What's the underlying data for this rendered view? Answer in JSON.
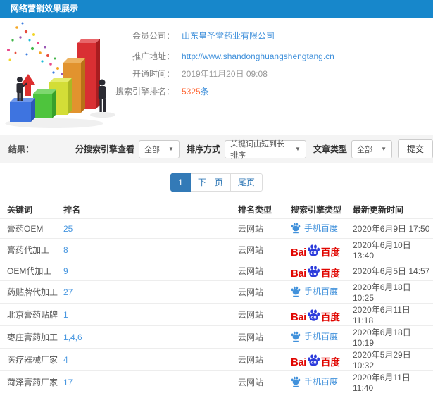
{
  "header": {
    "title": "网络营销效果展示",
    "bar_color": "#1787cb"
  },
  "info": {
    "company_label": "会员公司：",
    "company_value": "山东皇圣堂药业有限公司",
    "url_label": "推广地址：",
    "url_value": "http://www.shandonghuangshengtang.cn",
    "opened_label": "开通时间：",
    "opened_value": "2019年11月20日 09:08",
    "rank_label": "搜索引擎排名：",
    "rank_count": "5325",
    "rank_unit": "条"
  },
  "filters": {
    "result_label": "结果：",
    "engine_label": "分搜索引擎查看",
    "engine_value": "全部",
    "sort_label": "排序方式",
    "sort_value": "关键词由短到长排序",
    "type_label": "文章类型",
    "type_value": "全部",
    "submit_label": "提交"
  },
  "pagination": {
    "current": "1",
    "next": "下一页",
    "last": "尾页"
  },
  "table": {
    "headers": [
      "关键词",
      "排名",
      "排名类型",
      "搜索引擎类型",
      "最新更新时间"
    ],
    "engine_logos": {
      "mobile": {
        "label": "手机百度",
        "color": "#4191db"
      },
      "pc": {
        "bai": "Bai",
        "du": "du",
        "cn": "百度",
        "red": "#e10601",
        "blue": "#2b3bdb"
      }
    },
    "rows": [
      {
        "keyword": "膏药OEM",
        "rank": "25",
        "rank_type": "云网站",
        "engine": "mobile",
        "updated": "2020年6月9日 17:50"
      },
      {
        "keyword": "膏药代加工",
        "rank": "8",
        "rank_type": "云网站",
        "engine": "pc",
        "updated": "2020年6月10日 13:40"
      },
      {
        "keyword": "OEM代加工",
        "rank": "9",
        "rank_type": "云网站",
        "engine": "pc",
        "updated": "2020年6月5日 14:57"
      },
      {
        "keyword": "药贴牌代加工",
        "rank": "27",
        "rank_type": "云网站",
        "engine": "mobile",
        "updated": "2020年6月18日 10:25"
      },
      {
        "keyword": "北京膏药贴牌",
        "rank": "1",
        "rank_type": "云网站",
        "engine": "pc",
        "updated": "2020年6月11日 11:18"
      },
      {
        "keyword": "枣庄膏药加工",
        "rank": "1,4,6",
        "rank_type": "云网站",
        "engine": "mobile",
        "updated": "2020年6月18日 10:19"
      },
      {
        "keyword": "医疗器械厂家",
        "rank": "4",
        "rank_type": "云网站",
        "engine": "pc",
        "updated": "2020年5月29日 10:32"
      },
      {
        "keyword": "菏泽膏药厂家",
        "rank": "17",
        "rank_type": "云网站",
        "engine": "mobile",
        "updated": "2020年6月11日 11:40"
      }
    ]
  }
}
